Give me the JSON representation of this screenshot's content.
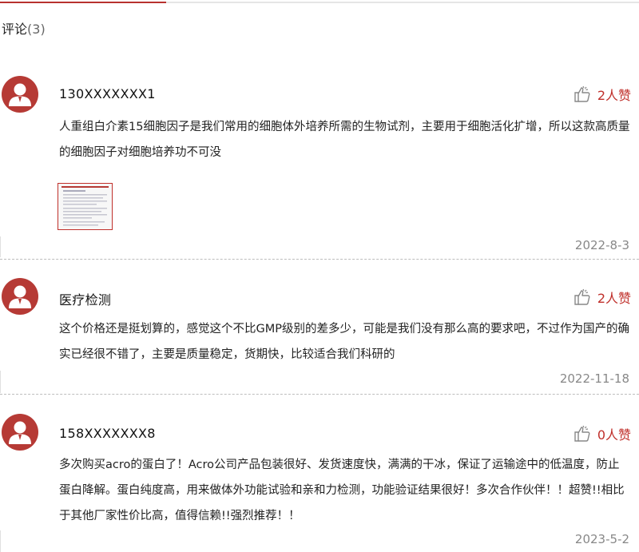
{
  "header": {
    "title": "评论",
    "count": "(3)"
  },
  "colors": {
    "accent": "#c0302b",
    "avatar": "#b63a35",
    "muted": "#888888"
  },
  "comments": [
    {
      "user": "130XXXXXXX1",
      "likes": "2人赞",
      "text": "人重组白介素15细胞因子是我们常用的细胞体外培养所需的生物试剂，主要用于细胞活化扩增，所以这款高质量的细胞因子对细胞培养功不可没",
      "has_image": true,
      "date": "2022-8-3"
    },
    {
      "user": "医疗检测",
      "likes": "2人赞",
      "text": "这个价格还是挺划算的，感觉这个不比GMP级别的差多少，可能是我们没有那么高的要求吧，不过作为国产的确实已经很不错了，主要是质量稳定，货期快，比较适合我们科研的",
      "has_image": false,
      "date": "2022-11-18"
    },
    {
      "user": "158XXXXXXX8",
      "likes": "0人赞",
      "text": "多次购买acro的蛋白了！Acro公司产品包装很好、发货速度快，满满的干冰，保证了运输途中的低温度，防止蛋白降解。蛋白纯度高，用来做体外功能试验和亲和力检测，功能验证结果很好！多次合作伙伴！！超赞!!相比于其他厂家性价比高，值得信赖!!强烈推荐！！",
      "has_image": false,
      "date": "2023-5-2"
    }
  ]
}
